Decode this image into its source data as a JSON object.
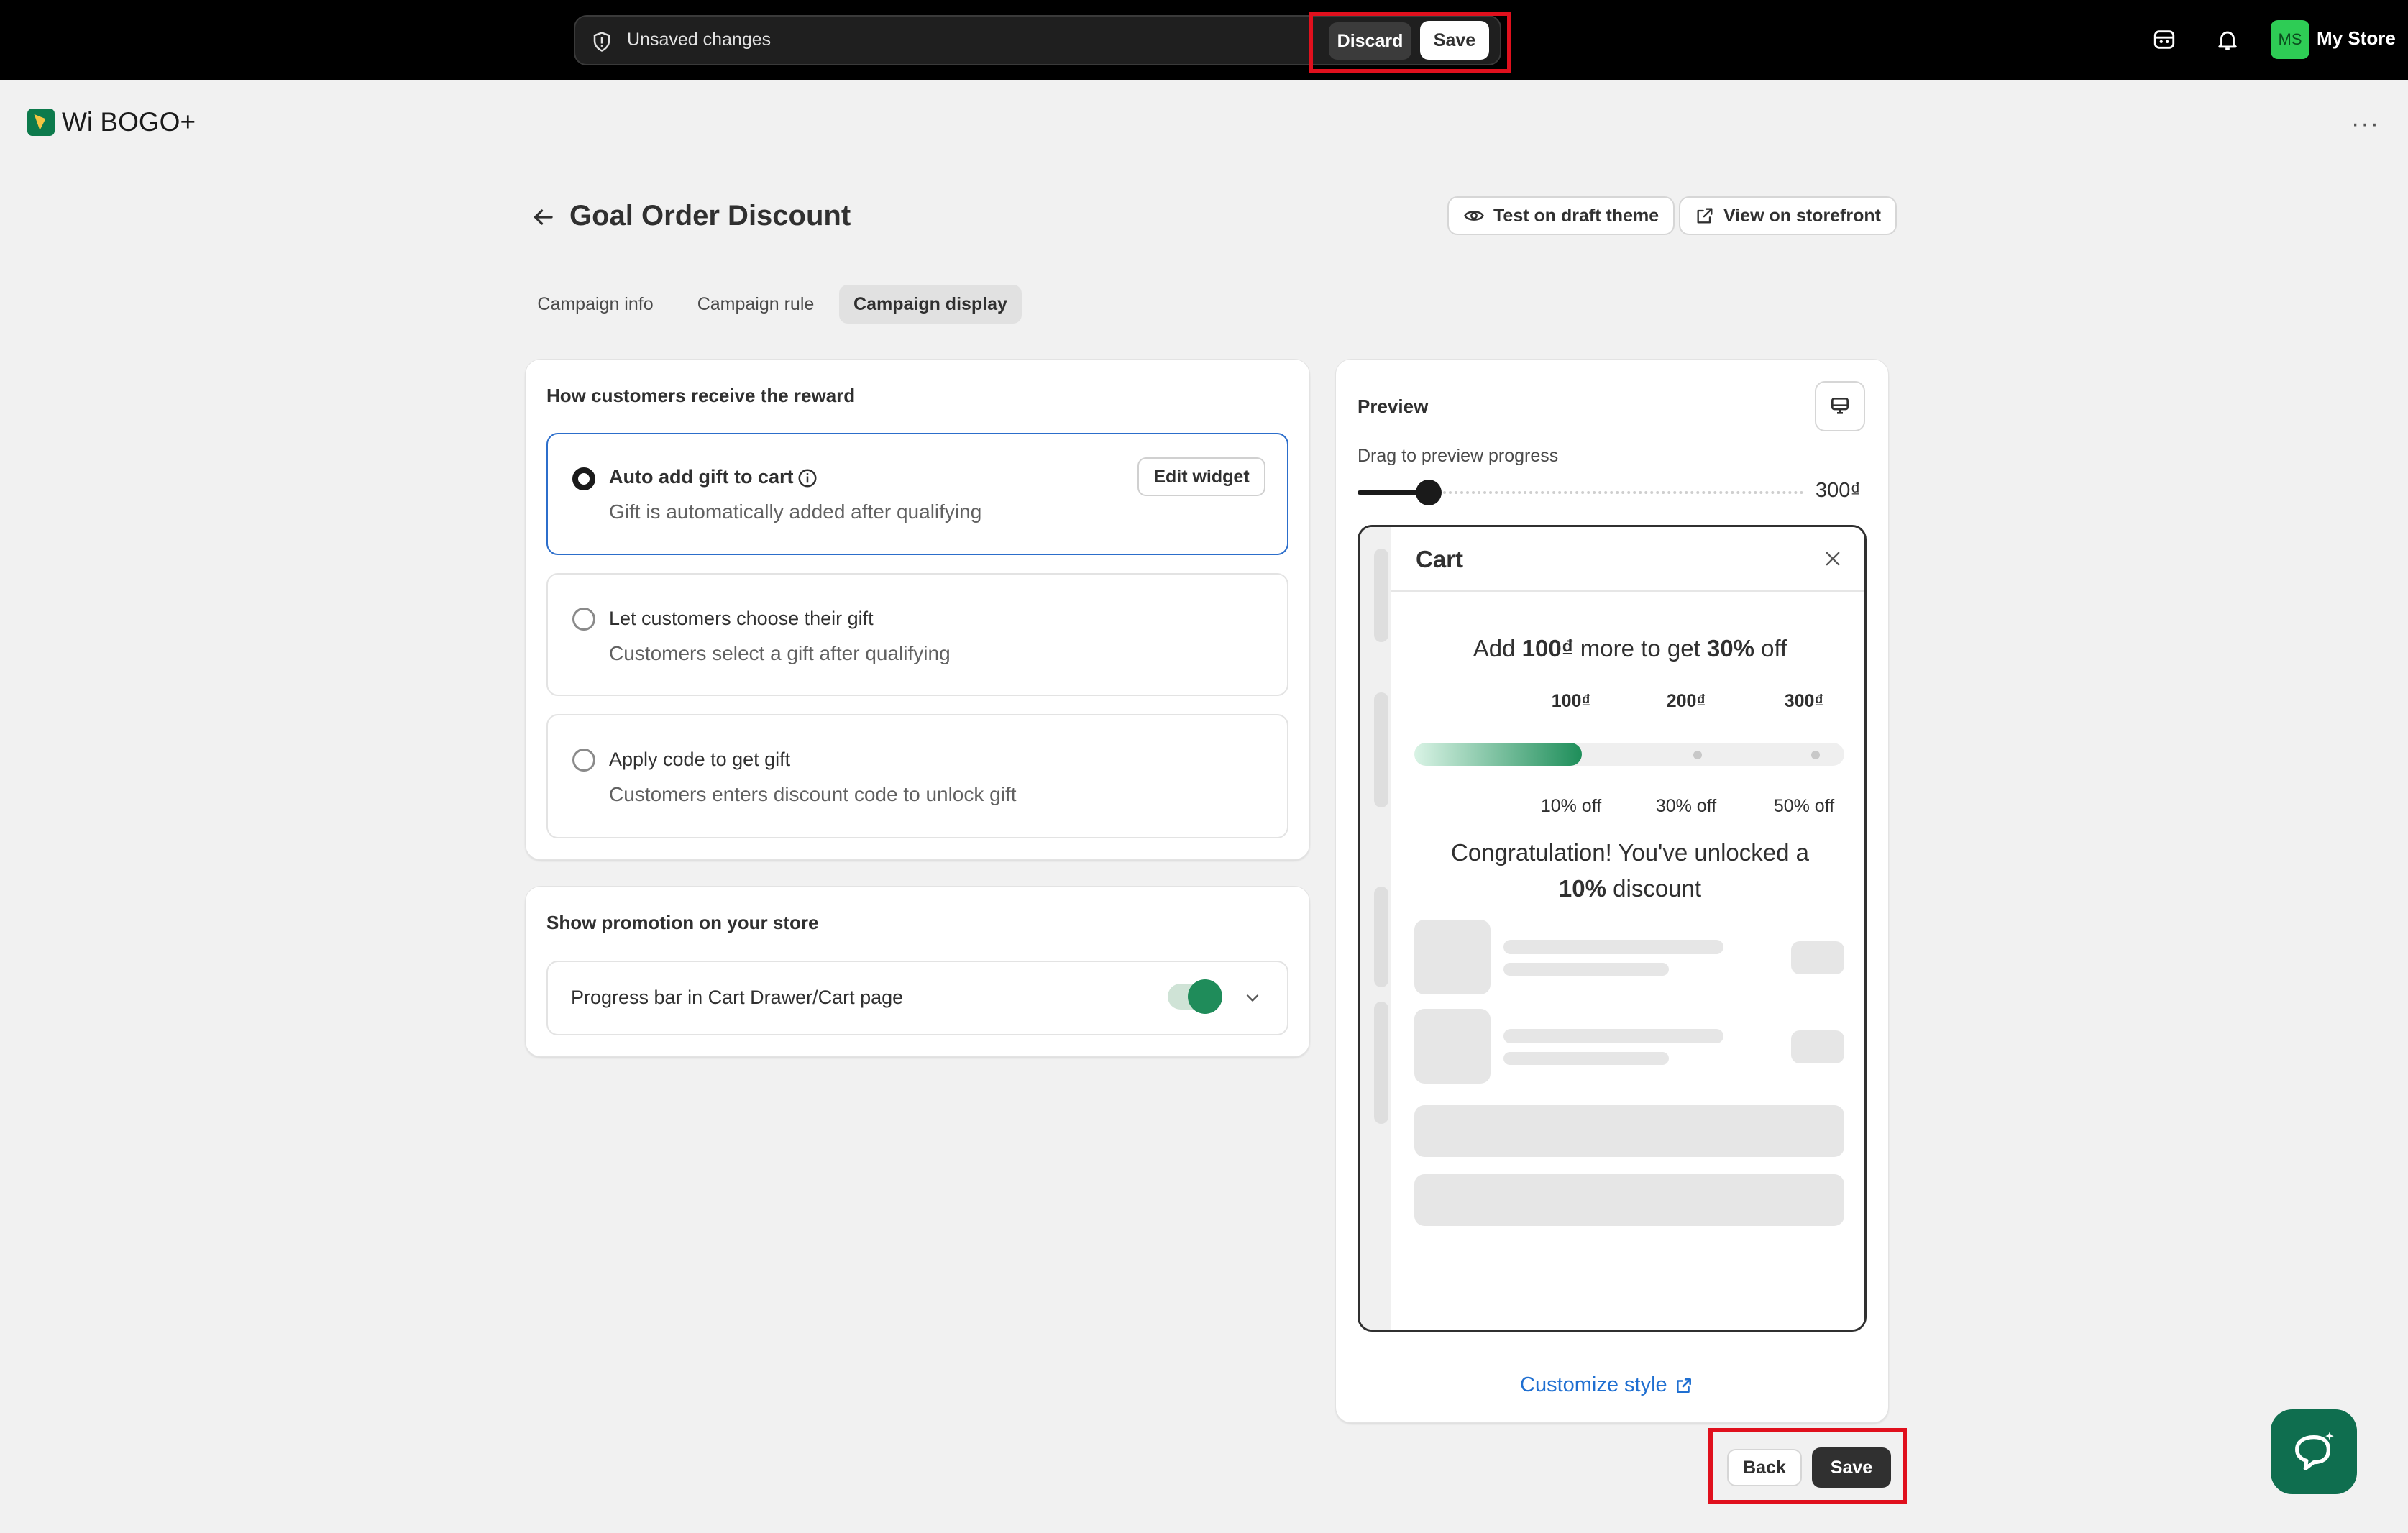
{
  "topbar": {
    "unsaved_text": "Unsaved changes",
    "discard_label": "Discard",
    "save_label": "Save",
    "avatar_initials": "MS",
    "store_name": "My Store"
  },
  "app": {
    "name": "Wi BOGO+",
    "more_label": "···"
  },
  "page": {
    "title": "Goal Order Discount",
    "test_draft_label": "Test on draft theme",
    "view_storefront_label": "View on storefront"
  },
  "tabs": [
    {
      "label": "Campaign info",
      "active": false
    },
    {
      "label": "Campaign rule",
      "active": false
    },
    {
      "label": "Campaign display",
      "active": true
    }
  ],
  "reward": {
    "title": "How customers receive the reward",
    "options": [
      {
        "label": "Auto add gift to cart",
        "description": "Gift is automatically added after qualifying",
        "selected": true
      },
      {
        "label": "Let customers choose their gift",
        "description": "Customers select a gift after qualifying",
        "selected": false
      },
      {
        "label": "Apply code to get gift",
        "description": "Customers enters discount code to unlock gift",
        "selected": false
      }
    ],
    "edit_widget_label": "Edit widget"
  },
  "promotion": {
    "title": "Show promotion on your store",
    "item_label": "Progress bar in Cart Drawer/Cart page",
    "enabled": true
  },
  "preview": {
    "title": "Preview",
    "drag_label": "Drag to preview progress",
    "slider_value_text": "300₫",
    "slider_fraction": 0.16,
    "cart": {
      "title": "Cart",
      "goal_prefix": "Add ",
      "goal_amount": "100₫",
      "goal_middle": " more to get ",
      "goal_percent": "30%",
      "goal_suffix": " off",
      "tiers": [
        {
          "amount": "100₫",
          "reward": "10% off"
        },
        {
          "amount": "200₫",
          "reward": "30% off"
        },
        {
          "amount": "300₫",
          "reward": "50% off"
        }
      ],
      "progress_fraction": 0.39,
      "congrats_line1": "Congratulation! You've unlocked a",
      "congrats_percent": "10%",
      "congrats_suffix": " discount"
    },
    "customize_label": "Customize style"
  },
  "footer": {
    "back_label": "Back",
    "save_label": "Save"
  },
  "colors": {
    "accent_green": "#1f8c5a",
    "highlight_red": "#e0101d",
    "link_blue": "#1f6fd1"
  }
}
